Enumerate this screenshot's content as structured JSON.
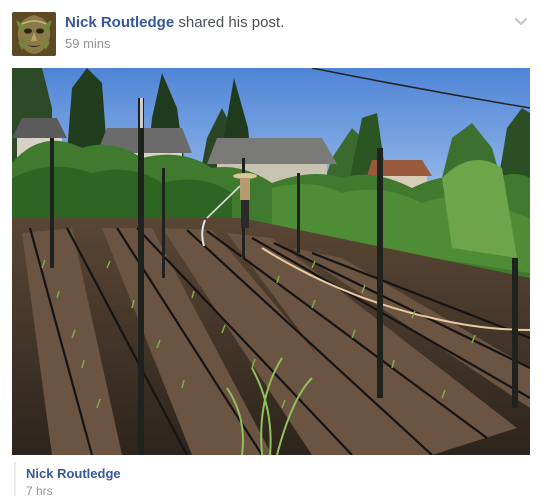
{
  "post": {
    "author": "Nick Routledge",
    "action": "shared his post.",
    "timestamp": "59 mins",
    "menu_icon": "chevron-down-icon",
    "avatar_icon": "green-man-face-avatar"
  },
  "photo": {
    "subject": "garden-rows-photo"
  },
  "original_post": {
    "author": "Nick Routledge",
    "timestamp": "7 hrs"
  },
  "colors": {
    "link": "#365899",
    "secondary_text": "#90949c",
    "action_text": "#4b4f56",
    "divider": "#e9ebee"
  }
}
